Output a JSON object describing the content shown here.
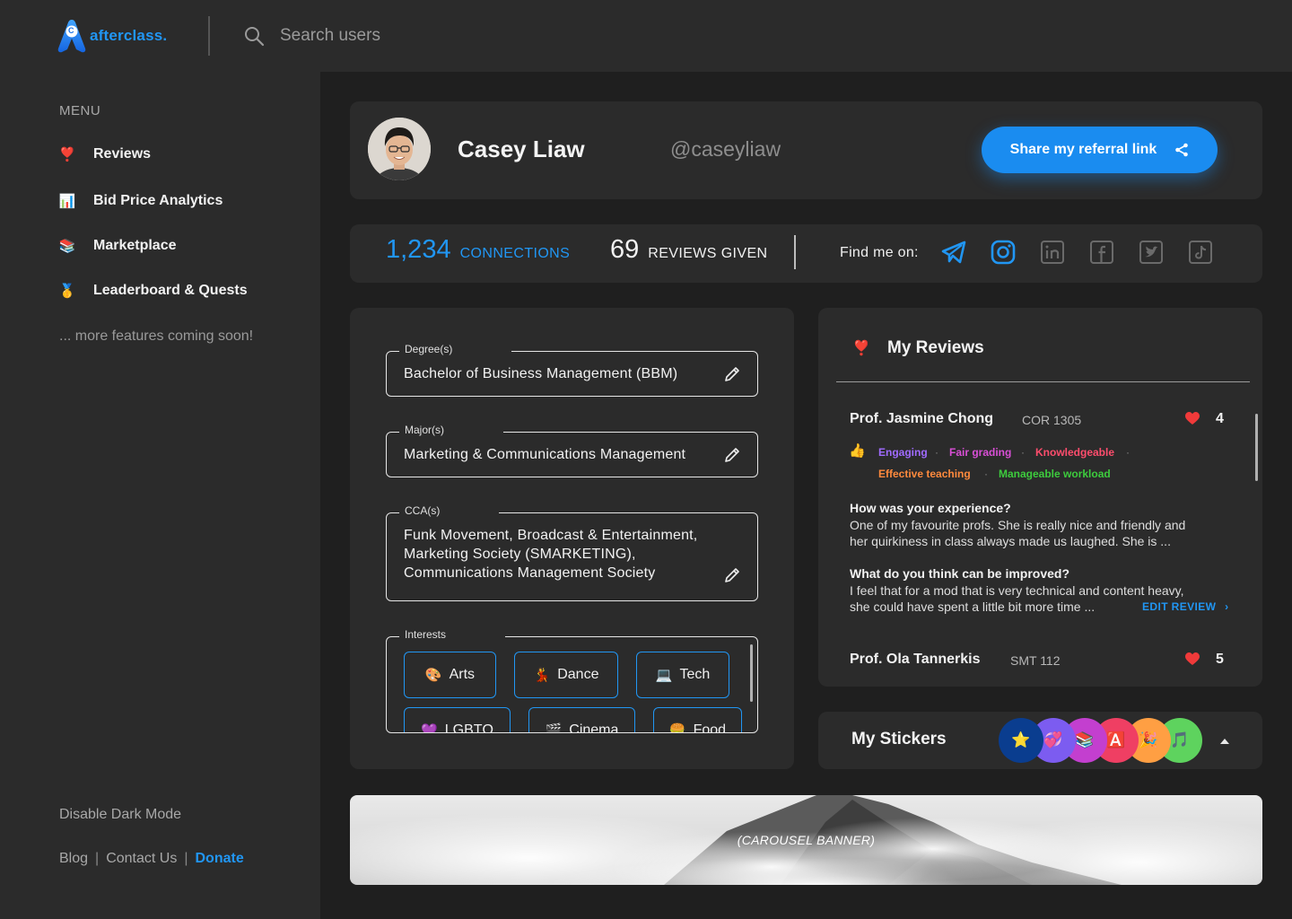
{
  "app": {
    "logo_text": "afterclass.",
    "logo_badge": "C",
    "brand_color": "#2196f3"
  },
  "search": {
    "placeholder": "Search users"
  },
  "sidebar": {
    "menu_heading": "MENU",
    "items": [
      {
        "emoji": "❣️",
        "label": "Reviews"
      },
      {
        "emoji": "📊",
        "label": "Bid Price Analytics"
      },
      {
        "emoji": "📚",
        "label": "Marketplace"
      },
      {
        "emoji": "🥇",
        "label": "Leaderboard & Quests"
      }
    ],
    "coming_soon": "... more features coming soon!",
    "dark_mode_toggle": "Disable Dark Mode",
    "footer": {
      "blog": "Blog",
      "sep": "|",
      "contact": "Contact Us",
      "donate": "Donate"
    }
  },
  "profile": {
    "name": "Casey Liaw",
    "handle": "@caseyliaw",
    "share_label": "Share my referral link"
  },
  "stats": {
    "connections_value": "1,234",
    "connections_label": "CONNECTIONS",
    "reviews_value": "69",
    "reviews_label": "REVIEWS GIVEN",
    "find_me_label": "Find me on:",
    "socials": [
      "telegram-icon",
      "instagram-icon",
      "linkedin-icon",
      "facebook-icon",
      "twitter-icon",
      "tiktok-icon"
    ]
  },
  "details": {
    "degree": {
      "label": "Degree(s)",
      "value": "Bachelor of Business Management (BBM)"
    },
    "major": {
      "label": "Major(s)",
      "value": "Marketing & Communications Management"
    },
    "cca": {
      "label": "CCA(s)",
      "lines": [
        "Funk Movement, Broadcast & Entertainment,",
        "Marketing Society (SMARKETING),",
        "Communications Management Society"
      ]
    },
    "interests": {
      "label": "Interests",
      "chips": [
        {
          "emoji": "🎨",
          "label": "Arts"
        },
        {
          "emoji": "💃",
          "label": "Dance"
        },
        {
          "emoji": "💻",
          "label": "Tech"
        }
      ],
      "partial_chips": [
        {
          "emoji": "💜",
          "label": "LGBTQ"
        },
        {
          "emoji": "🎬",
          "label": "Cinema"
        },
        {
          "emoji": "🍔",
          "label": "Food"
        }
      ]
    }
  },
  "reviews": {
    "title_emoji": "❣️",
    "title": "My Reviews",
    "items": [
      {
        "professor": "Prof. Jasmine Chong",
        "module": "COR 1305",
        "hearts": "4",
        "thumb": "👍",
        "tags": [
          {
            "label": "Engaging",
            "color": "#a06bff"
          },
          {
            "label": "Fair grading",
            "color": "#d94fd6"
          },
          {
            "label": "Knowledgeable",
            "color": "#ff4d6d"
          },
          {
            "label": "Effective teaching",
            "color": "#ff8a3d"
          },
          {
            "label": "Manageable workload",
            "color": "#3dcc3d"
          }
        ],
        "q1": "How was your experience?",
        "a1_lines": [
          "One of my favourite profs. She is really nice and friendly and",
          "her quirkiness in class always made us laughed. She is ..."
        ],
        "q2": "What do you think can be improved?",
        "a2_lines": [
          "I feel that for a mod that is very technical and content heavy,",
          "she could have spent a little bit more time ..."
        ],
        "edit_label": "EDIT REVIEW"
      },
      {
        "professor": "Prof. Ola Tannerkis",
        "module": "SMT 112",
        "hearts": "5"
      }
    ]
  },
  "stickers": {
    "title": "My Stickers",
    "items": [
      {
        "emoji": "⭐",
        "bg": "#0a3d8f"
      },
      {
        "emoji": "💞",
        "bg": "#7c5cf0"
      },
      {
        "emoji": "📚",
        "bg": "#c33fcf"
      },
      {
        "emoji": "🅰️",
        "bg": "#ef3f63"
      },
      {
        "emoji": "🎉",
        "bg": "#ff9f43"
      },
      {
        "emoji": "🎵",
        "bg": "#5ed35e"
      }
    ]
  },
  "banner": {
    "label": "(CAROUSEL BANNER)"
  }
}
